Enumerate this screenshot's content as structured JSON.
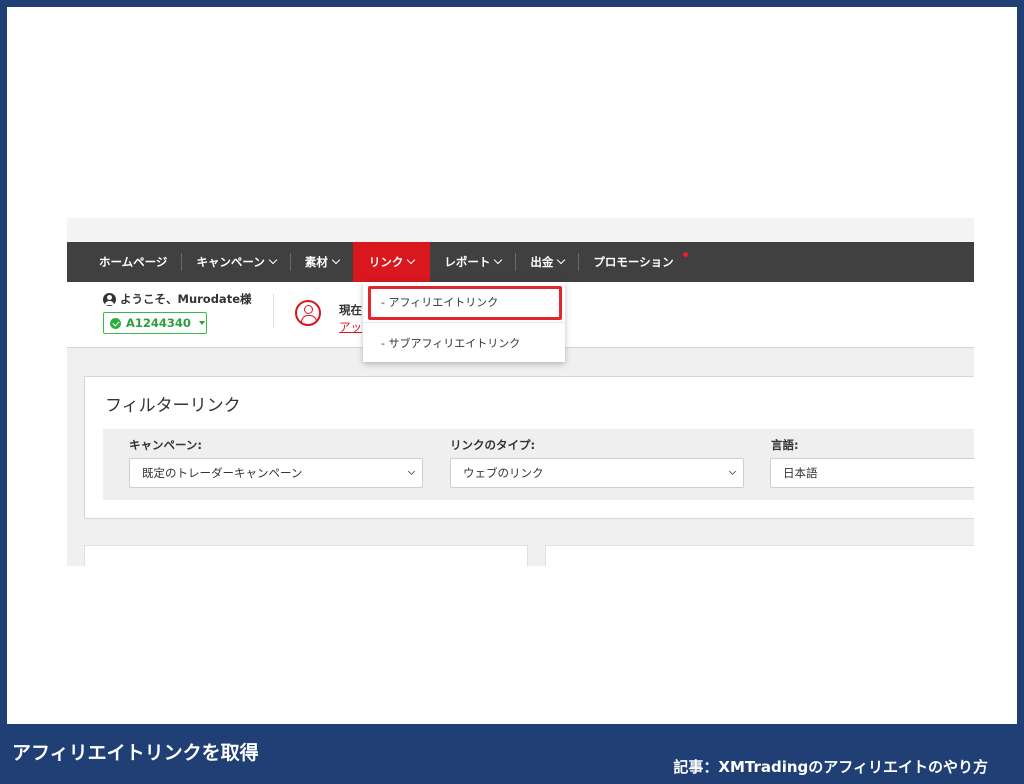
{
  "nav": {
    "items": [
      {
        "label": "ホームページ",
        "caret": false
      },
      {
        "label": "キャンペーン",
        "caret": true
      },
      {
        "label": "素材",
        "caret": true
      },
      {
        "label": "リンク",
        "caret": true,
        "active": true
      },
      {
        "label": "レポート",
        "caret": true
      },
      {
        "label": "出金",
        "caret": true
      },
      {
        "label": "プロモーション",
        "caret": false,
        "dot": true
      }
    ]
  },
  "user": {
    "welcome": "ようこそ、Murodate様",
    "account_id": "A1244340"
  },
  "status": {
    "label": "現在",
    "link": "アッ"
  },
  "dropdown": {
    "items": [
      "- アフィリエイトリンク",
      "- サブアフィリエイトリンク"
    ]
  },
  "filter": {
    "title": "フィルターリンク",
    "fields": [
      {
        "label": "キャンペーン:",
        "value": "既定のトレーダーキャンペーン"
      },
      {
        "label": "リンクのタイプ:",
        "value": "ウェブのリンク"
      },
      {
        "label": "言語:",
        "value": "日本語"
      }
    ]
  },
  "footer": {
    "title": "アフィリエイトリンクを取得",
    "subtitle": "記事：XMTradingのアフィリエイトのやり方"
  },
  "colors": {
    "navbar": "#404040",
    "active": "#d8171f",
    "frame": "#1f3f75",
    "account_green": "#2e9e3d"
  }
}
